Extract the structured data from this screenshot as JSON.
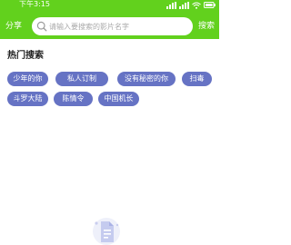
{
  "status_bar": {
    "time": "下午3:15"
  },
  "header": {
    "share_label": "分享",
    "search_placeholder": "请输入要搜索的影片名字",
    "search_label": "搜索"
  },
  "hot_search": {
    "title": "热门搜索",
    "tags": [
      "少年的你",
      "私人订制",
      "没有秘密的你",
      "扫毒",
      "斗罗大陆",
      "陈情令",
      "中国机长"
    ]
  },
  "colors": {
    "accent_green": "#62d11d",
    "tag_purple": "#6673c4"
  }
}
